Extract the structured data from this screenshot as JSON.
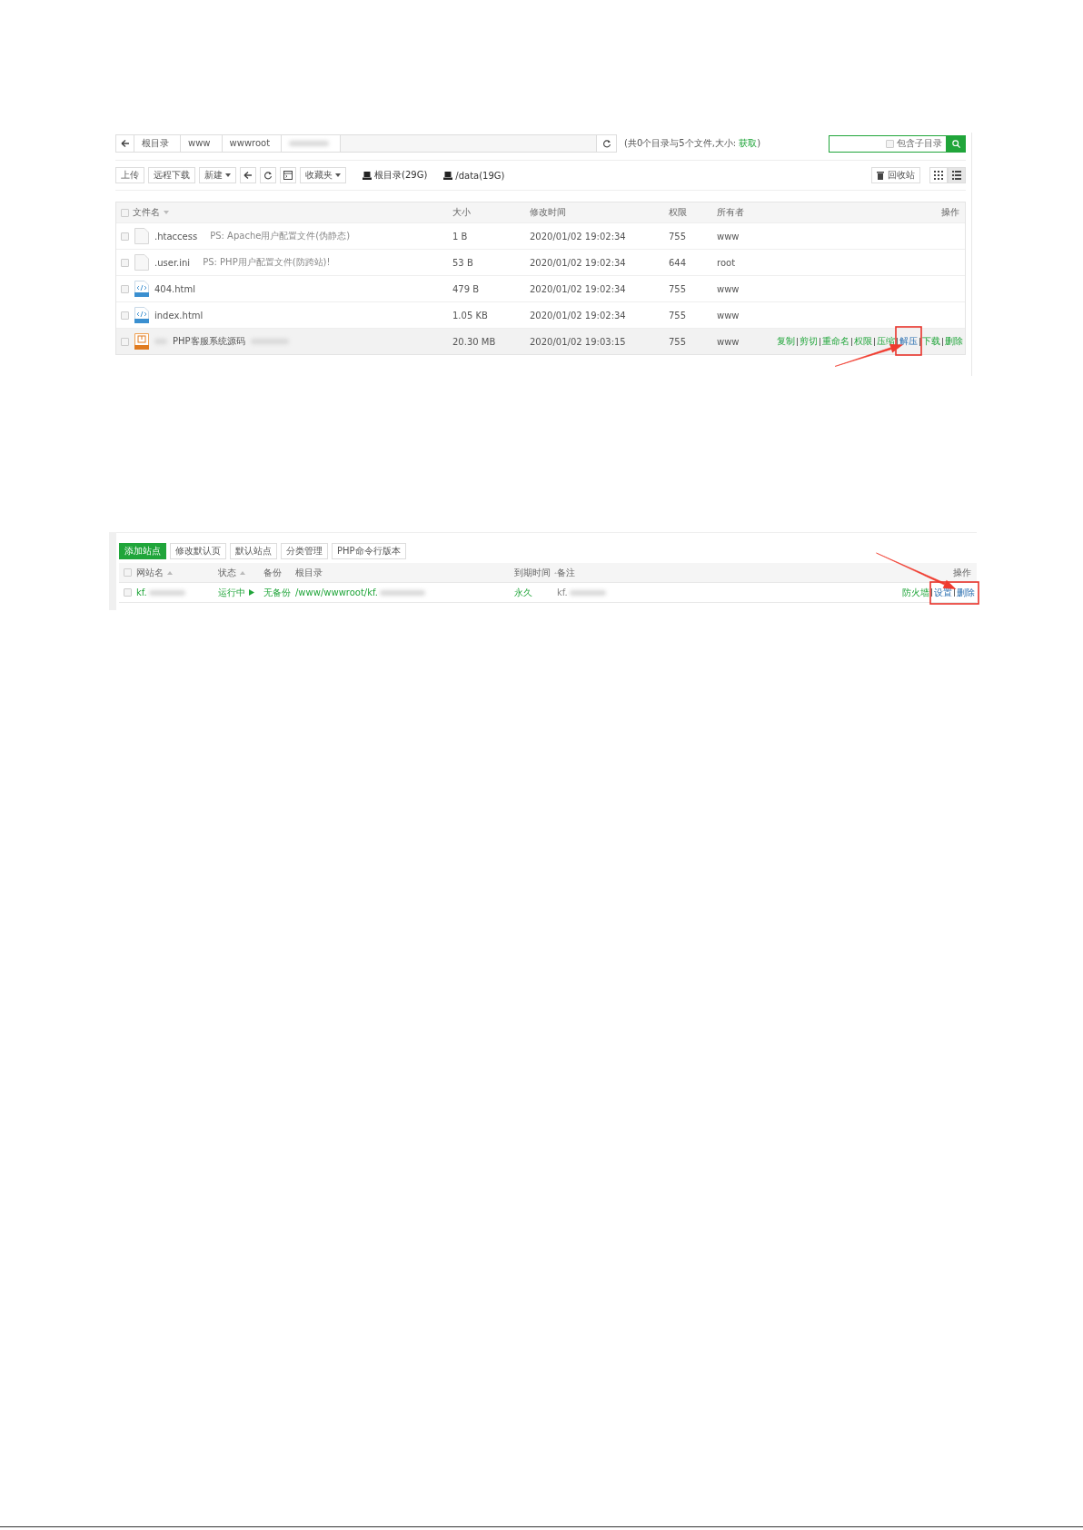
{
  "file_manager": {
    "breadcrumb": {
      "items": [
        "根目录",
        "www",
        "wwwroot"
      ],
      "redacted_tail": true
    },
    "summary": {
      "text": "(共0个目录与5个文件,大小:",
      "link": "获取",
      "close": ")"
    },
    "search": {
      "checkbox_label": "包含子目录",
      "checked": false
    },
    "toolbar": [
      {
        "kind": "text",
        "label": "上传"
      },
      {
        "kind": "text",
        "label": "远程下载"
      },
      {
        "kind": "dropdown",
        "label": "新建"
      },
      {
        "kind": "back"
      },
      {
        "kind": "refresh"
      },
      {
        "kind": "terminal"
      },
      {
        "kind": "dropdown",
        "label": "收藏夹"
      }
    ],
    "disks": [
      "根目录(29G)",
      "/data(19G)"
    ],
    "recycle": "回收站",
    "view_modes": [
      {
        "kind": "grid",
        "selected": false
      },
      {
        "kind": "list",
        "selected": true
      }
    ],
    "columns": [
      "文件名",
      "大小",
      "修改时间",
      "权限",
      "所有者",
      "操作"
    ],
    "select_all": {
      "checked": false
    },
    "rows": [
      {
        "kind": "blank",
        "name": ".htaccess",
        "note": "PS: Apache用户配置文件(伪静态)",
        "size": "1 B",
        "modified": "2020/01/02 19:02:34",
        "permission": "755",
        "owner": "www",
        "checked": false,
        "highlighted": false,
        "redacted": false,
        "actions": []
      },
      {
        "kind": "blank",
        "name": ".user.ini",
        "note": "PS: PHP用户配置文件(防跨站)!",
        "size": "53 B",
        "modified": "2020/01/02 19:02:34",
        "permission": "644",
        "owner": "root",
        "checked": false,
        "highlighted": false,
        "redacted": false,
        "actions": []
      },
      {
        "kind": "html",
        "name": "404.html",
        "size": "479 B",
        "modified": "2020/01/02 19:02:34",
        "permission": "755",
        "owner": "www",
        "checked": false,
        "highlighted": false,
        "redacted": false,
        "actions": []
      },
      {
        "kind": "html",
        "name": "index.html",
        "size": "1.05 KB",
        "modified": "2020/01/02 19:02:34",
        "permission": "755",
        "owner": "www",
        "checked": false,
        "highlighted": false,
        "redacted": false,
        "actions": []
      },
      {
        "kind": "zip",
        "name": "PHP客服系统源码",
        "size": "20.30 MB",
        "modified": "2020/01/02 19:03:15",
        "permission": "755",
        "owner": "www",
        "checked": false,
        "highlighted": true,
        "redacted": true,
        "actions": [
          {
            "label": "复制",
            "marked": false
          },
          {
            "label": "剪切",
            "marked": false
          },
          {
            "label": "重命名",
            "marked": false
          },
          {
            "label": "权限",
            "marked": false
          },
          {
            "label": "压缩",
            "marked": false
          },
          {
            "label": "解压",
            "marked": true
          },
          {
            "label": "下载",
            "marked": false
          },
          {
            "label": "删除",
            "marked": false
          }
        ]
      }
    ]
  },
  "sites": {
    "buttons": [
      {
        "label": "添加站点",
        "primary": true
      },
      {
        "label": "修改默认页",
        "primary": false
      },
      {
        "label": "默认站点",
        "primary": false
      },
      {
        "label": "分类管理",
        "primary": false
      },
      {
        "label": "PHP命令行版本",
        "primary": false
      }
    ],
    "select_all": {
      "checked": false
    },
    "columns": [
      {
        "label": "网站名",
        "sortable": true
      },
      {
        "label": "状态",
        "sortable": true
      },
      {
        "label": "备份",
        "sortable": false
      },
      {
        "label": "根目录",
        "sortable": false
      },
      {
        "label": "到期时间",
        "sortable": true
      },
      {
        "label": "备注",
        "sortable": false
      },
      {
        "label": "操作",
        "sortable": false
      }
    ],
    "rows": [
      {
        "checked": false,
        "name": "kf.",
        "status": "运行中",
        "running": true,
        "backup": "无备份",
        "root": "/www/wwwroot/kf.",
        "expiry": "永久",
        "note": "kf.",
        "actions": [
          {
            "label": "防火墙",
            "marked": false
          },
          {
            "label": "设置",
            "marked": true
          },
          {
            "label": "删除",
            "marked": true
          }
        ]
      }
    ]
  }
}
